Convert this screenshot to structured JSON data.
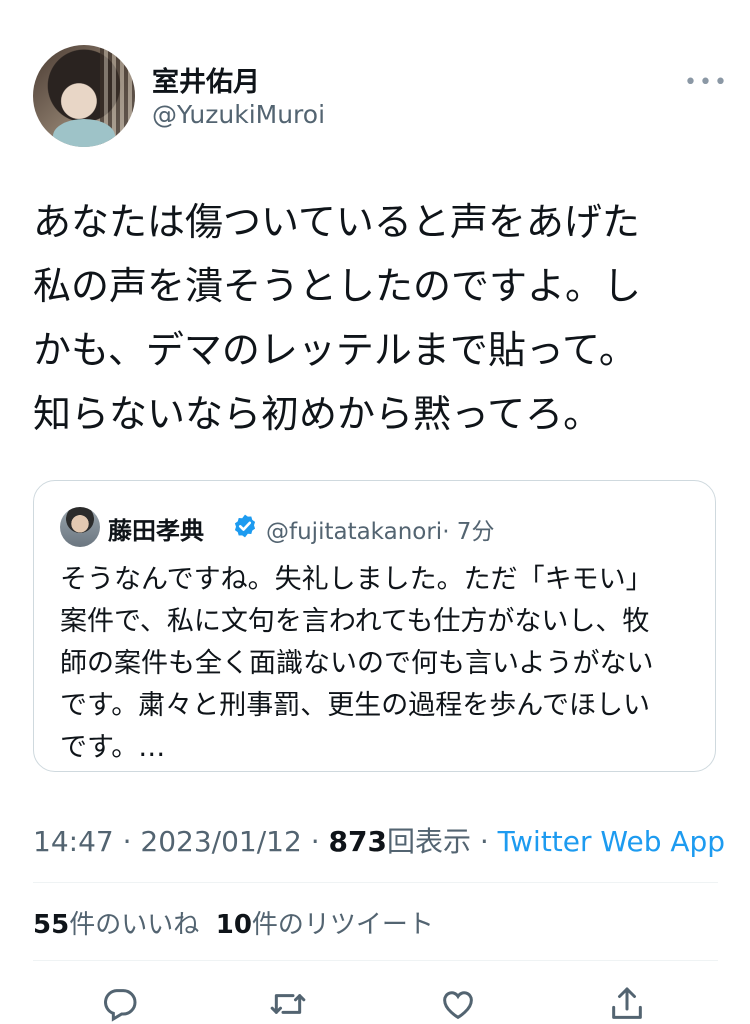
{
  "author": {
    "display_name": "室井佑月",
    "handle": "@YuzukiMuroi"
  },
  "more_icon": "ellipsis-icon",
  "tweet_lines": [
    "あなたは傷ついていると声をあげた",
    "私の声を潰そうとしたのですよ。し",
    "かも、デマのレッテルまで貼って。",
    "知らないなら初めから黙ってろ。"
  ],
  "quote": {
    "display_name": "藤田孝典",
    "verified_icon": "verified-badge-icon",
    "handle": "@fujitatakanori",
    "time": "· 7分",
    "lines": [
      "そうなんですね。失礼しました。ただ「キモい」",
      "案件で、私に文句を言われても仕方がないし、牧",
      "師の案件も全く面識ないので何も言いようがない",
      "です。粛々と刑事罰、更生の過程を歩んでほしい",
      "です。…"
    ]
  },
  "meta": {
    "time": "14:47",
    "sep1": " · ",
    "date": "2023/01/12",
    "sep2": " · ",
    "views": "873",
    "views_label": "回表示",
    "sep3": " · ",
    "app": "Twitter Web App"
  },
  "stats": {
    "likes_count": "55",
    "likes_label": "件のいいね",
    "retweets_count": "10",
    "retweets_label": "件のリツイート"
  },
  "actions": [
    "reply-icon",
    "retweet-icon",
    "like-icon",
    "share-icon"
  ],
  "colors": {
    "text": "#0f1419",
    "secondary": "#536471",
    "link": "#1d9bf0",
    "border": "#cfd9de"
  }
}
